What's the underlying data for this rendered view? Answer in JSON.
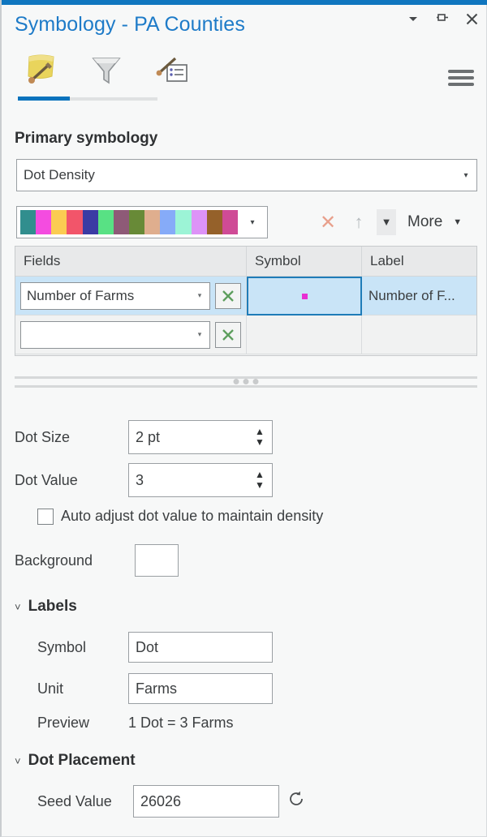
{
  "window": {
    "title": "Symbology - PA Counties",
    "accent_color": "#1076bf",
    "title_color": "#1e7bc8",
    "controls": [
      {
        "name": "menu-dropdown",
        "glyph": "▾"
      },
      {
        "name": "auto-hide-pin",
        "glyph": "pin"
      },
      {
        "name": "close",
        "glyph": "✕"
      }
    ]
  },
  "tabs": [
    {
      "name": "gallery-tab",
      "icon": "symbology-gallery-icon",
      "active": true
    },
    {
      "name": "vary-by-attribute-tab",
      "icon": "funnel-icon",
      "active": false
    },
    {
      "name": "advanced-symbol-options-tab",
      "icon": "brush-list-icon",
      "active": false
    }
  ],
  "options_menu": {
    "icon": "hamburger-menu-icon"
  },
  "primary": {
    "heading": "Primary symbology",
    "selected": "Dot Density",
    "dropdown_arrow": "▾"
  },
  "color_scheme": {
    "dropdown_arrow": "▾",
    "colors": [
      "#318e8e",
      "#f44ce0",
      "#fbcc52",
      "#f2556a",
      "#3b3ba4",
      "#58e184",
      "#8e5a77",
      "#688a37",
      "#dfae8e",
      "#86abf8",
      "#9cf4d6",
      "#dd93f7",
      "#95612a",
      "#cf4b96"
    ]
  },
  "ramp_tools": {
    "remove": {
      "name": "remove-icon",
      "glyph": "✕",
      "enabled": false
    },
    "move_up": {
      "name": "move-up-arrow-icon",
      "glyph": "↑",
      "enabled": false
    },
    "move_down": {
      "name": "move-down-arrow-icon",
      "glyph": "▼",
      "enabled": true
    },
    "more_label": "More",
    "more_arrow": "▼"
  },
  "table": {
    "headers": [
      "Fields",
      "Symbol",
      "Label"
    ],
    "rows": [
      {
        "field": "Number of Farms",
        "field_arrow": "▾",
        "expression_icon": "arcade-expression-icon",
        "symbol_color": "#e82fd2",
        "label": "Number of F...",
        "selected": true
      },
      {
        "field": "",
        "field_arrow": "▾",
        "expression_icon": "arcade-expression-icon",
        "symbol_color": "",
        "label": "",
        "selected": false
      }
    ]
  },
  "dot_size": {
    "label": "Dot Size",
    "value": "2 pt"
  },
  "dot_value": {
    "label": "Dot Value",
    "value": "3"
  },
  "auto_adjust": {
    "label": "Auto adjust dot value to maintain density",
    "checked": false
  },
  "background": {
    "label": "Background",
    "color": "#ffffff"
  },
  "labels_group": {
    "title": "Labels",
    "chevron": "˅",
    "symbol_label": "Symbol",
    "symbol_value": "Dot",
    "unit_label": "Unit",
    "unit_value": "Farms",
    "preview_label": "Preview",
    "preview_value": "1 Dot = 3 Farms"
  },
  "dot_placement_group": {
    "title": "Dot Placement",
    "chevron": "˅",
    "seed_label": "Seed Value",
    "seed_value": "26026",
    "refresh_icon": "refresh-icon"
  }
}
